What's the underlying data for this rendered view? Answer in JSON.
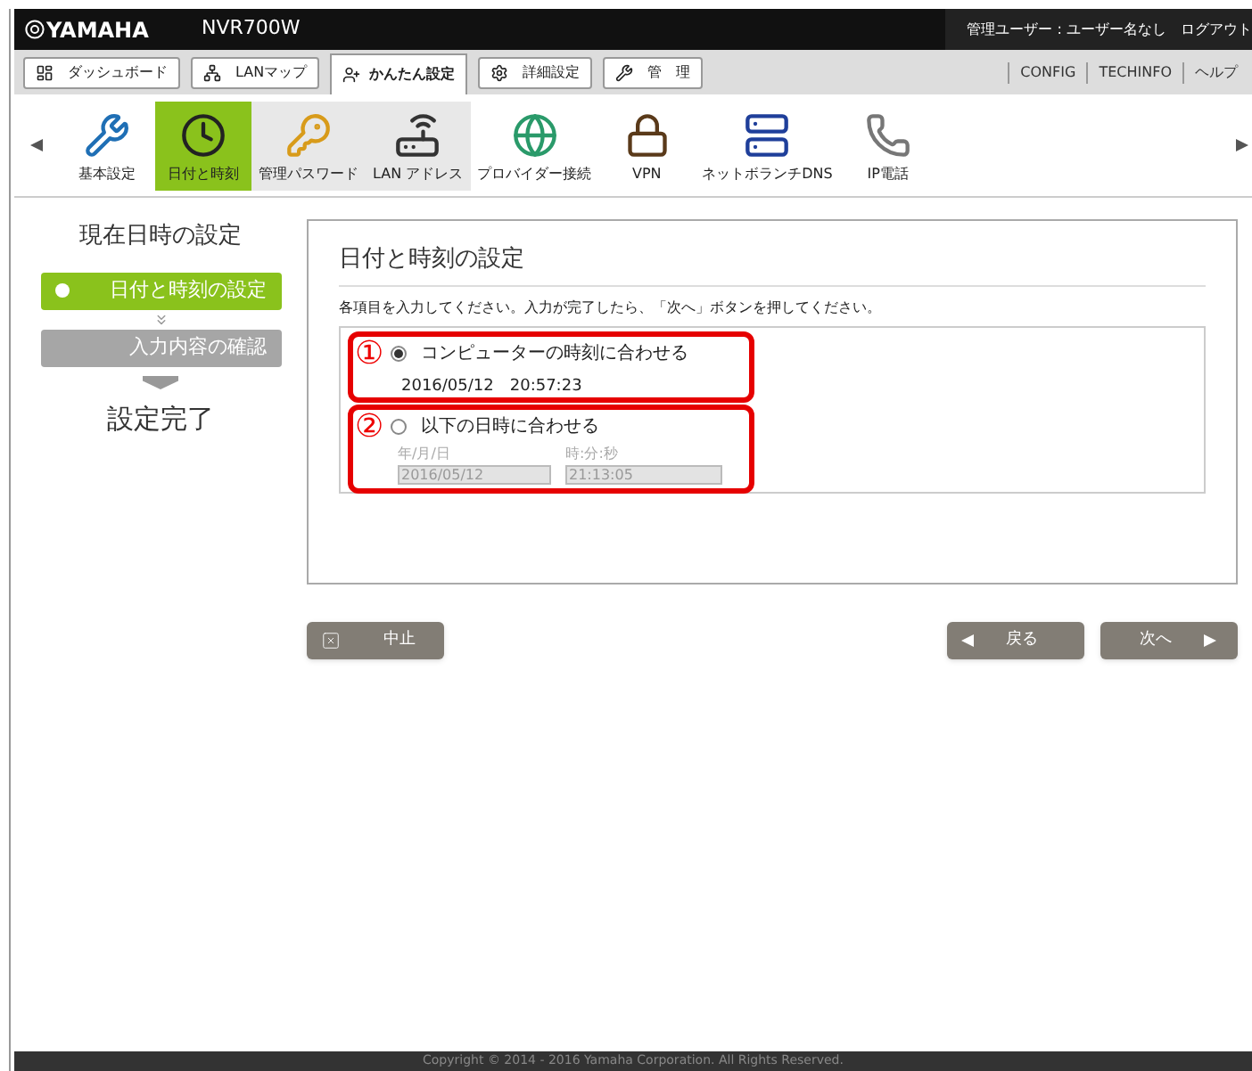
{
  "header": {
    "logo": "YAMAHA",
    "model": "NVR700W",
    "user": "管理ユーザー : ユーザー名なし",
    "logout": "ログアウト"
  },
  "tabs": [
    {
      "label": "ダッシュボード",
      "selected": false
    },
    {
      "label": "LANマップ",
      "selected": false
    },
    {
      "label": "かんたん設定",
      "selected": true
    },
    {
      "label": "詳細設定",
      "selected": false
    },
    {
      "label": "管　理",
      "selected": false
    }
  ],
  "links": [
    "CONFIG",
    "TECHINFO",
    "ヘルプ"
  ],
  "menu": {
    "items": [
      {
        "label": "基本設定",
        "selected": false
      },
      {
        "label": "日付と時刻",
        "selected": true
      },
      {
        "label": "管理パスワード",
        "selected": false
      },
      {
        "label": "LAN アドレス",
        "selected": false
      },
      {
        "label": "プロバイダー接続",
        "selected": false
      },
      {
        "label": "VPN",
        "selected": false
      },
      {
        "label": "ネットボランチDNS",
        "selected": false
      },
      {
        "label": "IP電話",
        "selected": false
      }
    ]
  },
  "sidebar": {
    "title": "現在日時の設定",
    "steps": [
      {
        "label": "日付と時刻の設定",
        "kind": "current"
      },
      {
        "label": "入力内容の確認",
        "kind": "pending"
      },
      {
        "label": "設定完了",
        "kind": "final"
      }
    ]
  },
  "panel": {
    "title": "日付と時刻の設定",
    "instruction": "各項目を入力してください。入力が完了したら、「次へ」ボタンを押してください。",
    "options": [
      {
        "number": "①",
        "label": "コンピューターの時刻に合わせる",
        "selected": true,
        "kind": "current",
        "value": "2016/05/12　20:57:23"
      },
      {
        "number": "②",
        "label": "以下の日時に合わせる",
        "selected": false,
        "kind": "manual",
        "date_label": "年/月/日",
        "date": "2016/05/12",
        "time_label": "時:分:秒",
        "time": "21:13:05"
      }
    ]
  },
  "buttons": {
    "cancel": "中止",
    "back": "戻る",
    "next": "次へ"
  },
  "footer": "Copyright © 2014 - 2016 Yamaha Corporation. All Rights Reserved."
}
